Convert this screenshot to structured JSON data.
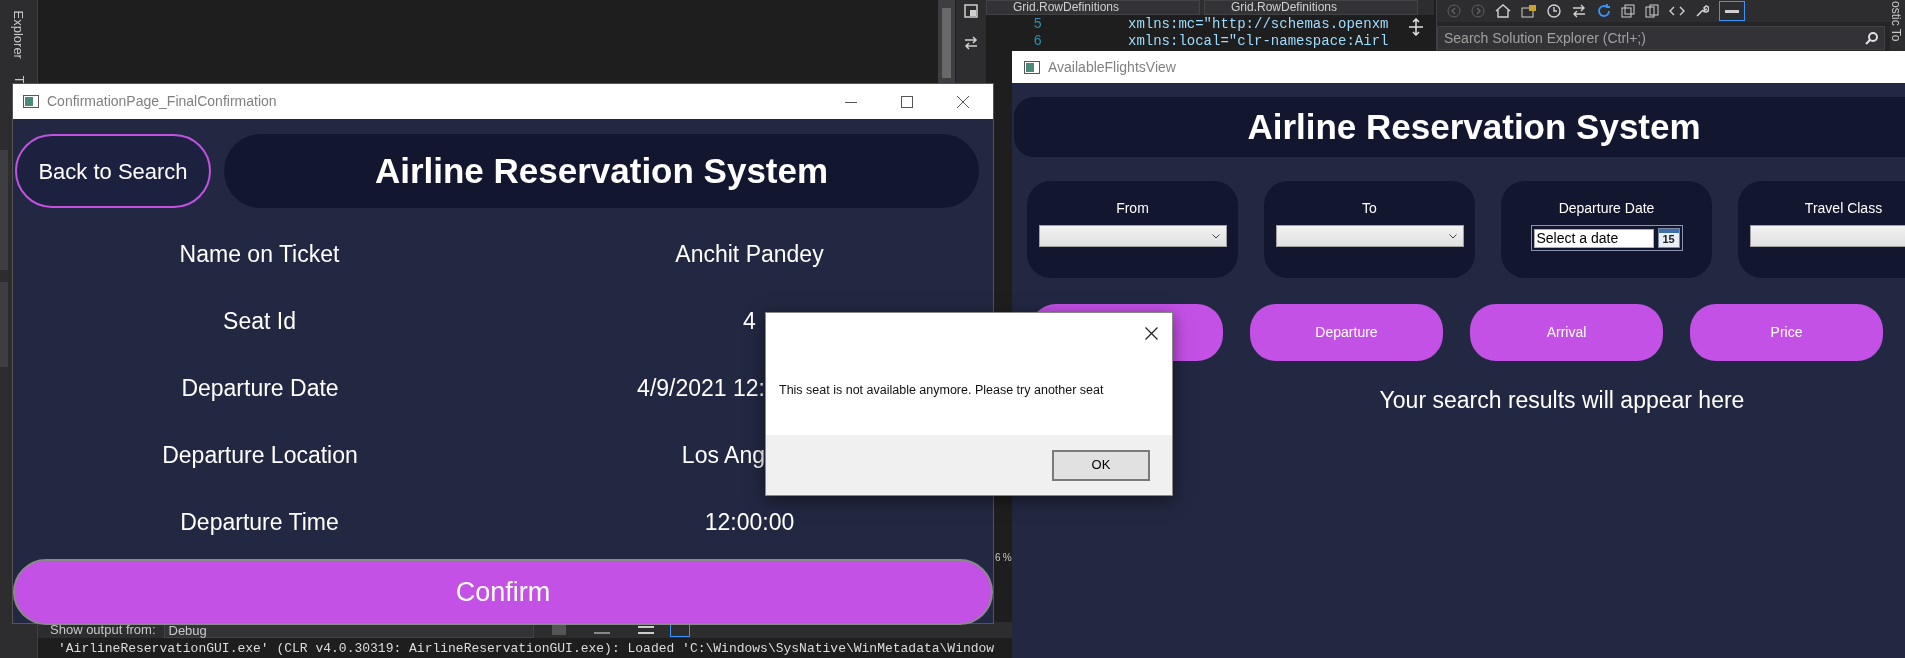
{
  "ide": {
    "side_tabs": [
      "Explorer",
      "T"
    ],
    "editor_dropdowns": [
      "Grid.RowDefinitions",
      "Grid.RowDefinitions"
    ],
    "code_lines": [
      {
        "number": "5",
        "text": "xmlns:mc=\"http://schemas.openxm"
      },
      {
        "number": "6",
        "text": "xmlns:local=\"clr-namespace:Airl"
      }
    ],
    "solution_search": {
      "placeholder": "Search Solution Explorer (Ctrl+;)"
    },
    "right_tab": "ostic To",
    "zoom_level": "6 %",
    "output": {
      "label": "Show output from:",
      "source": "Debug",
      "line": "'AirlineReservationGUI.exe' (CLR v4.0.30319: AirlineReservationGUI.exe): Loaded 'C:\\Windows\\SysNative\\WinMetadata\\Window"
    }
  },
  "confirmation_window": {
    "title": "ConfirmationPage_FinalConfirmation",
    "back_button": "Back to Search",
    "heading": "Airline Reservation System",
    "details": [
      {
        "label": "Name on Ticket",
        "value": "Anchit Pandey",
        "kind": "plain"
      },
      {
        "label": "Seat Id",
        "value": "4",
        "kind": "plain"
      },
      {
        "label": "Departure Date",
        "value": "4/9/2021 12:",
        "kind": "covered"
      },
      {
        "label": "Departure Location",
        "value": "Los Ang",
        "kind": "covered"
      },
      {
        "label": "Departure Time",
        "value": "12:00:00",
        "kind": "plain"
      }
    ],
    "confirm_button": "Confirm"
  },
  "flights_window": {
    "title": "AvailableFlightsView",
    "heading": "Airline Reservation System",
    "filters": [
      {
        "label": "From",
        "kind": "dropdown"
      },
      {
        "label": "To",
        "kind": "dropdown"
      },
      {
        "label": "Departure Date",
        "kind": "date",
        "placeholder": "Select a date",
        "calendar_day": "15"
      },
      {
        "label": "Travel Class",
        "kind": "dropdown"
      }
    ],
    "sort_buttons": [
      {
        "kind": "covered"
      },
      {
        "kind": "plain",
        "label": "Departure"
      },
      {
        "kind": "plain",
        "label": "Arrival"
      },
      {
        "kind": "plain",
        "label": "Price"
      }
    ],
    "results_message": "Your search results will appear here"
  },
  "dialog": {
    "message": "This seat is not available anymore. Please try another seat",
    "ok_button": "OK"
  }
}
